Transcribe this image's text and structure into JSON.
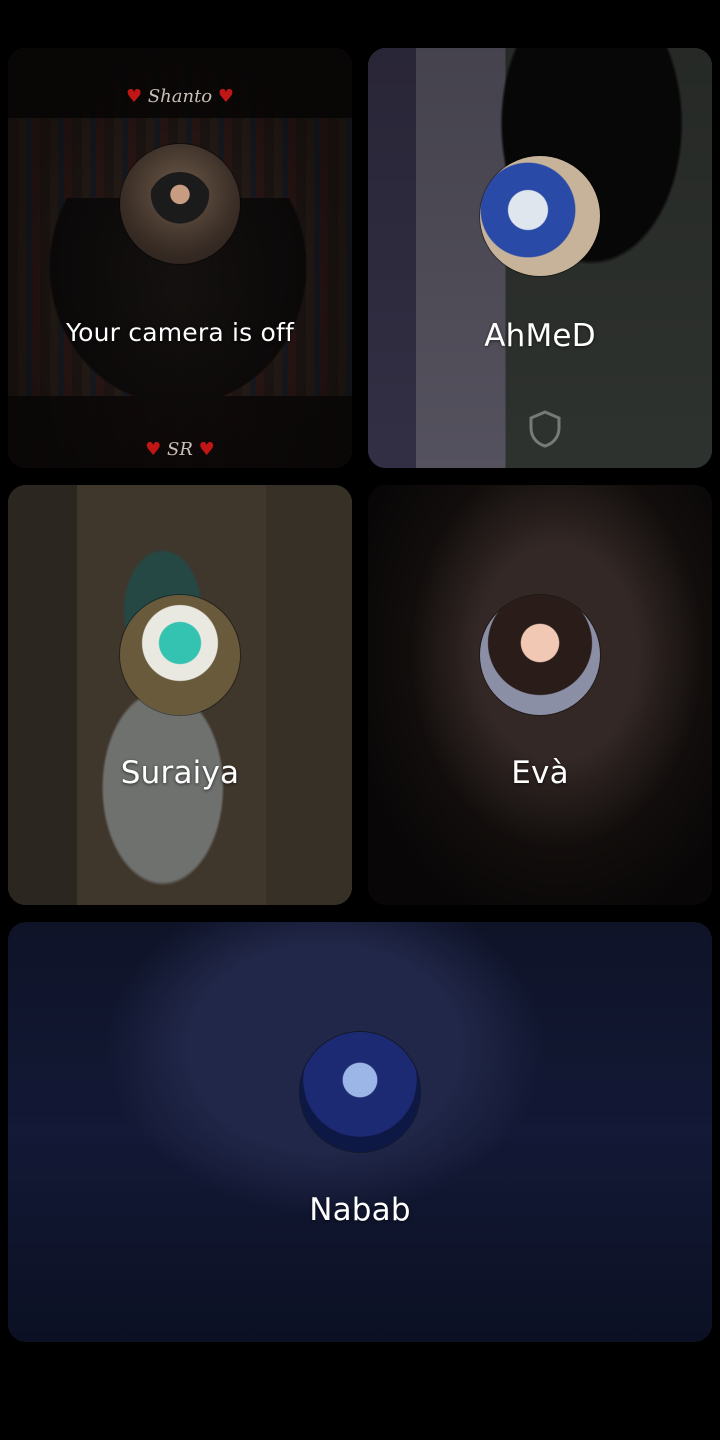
{
  "participants": [
    {
      "id": "self",
      "label": "Your camera is off",
      "banner_top": "Shanto",
      "banner_bottom": "SR",
      "is_self": true
    },
    {
      "id": "ahmed",
      "label": "AhMeD",
      "is_self": false
    },
    {
      "id": "suraiya",
      "label": "Suraiya",
      "is_self": false
    },
    {
      "id": "eva",
      "label": "Evà",
      "is_self": false
    },
    {
      "id": "nabab",
      "label": "Nabab",
      "is_self": false
    }
  ],
  "icons": {
    "self_avatar": "profile-photo",
    "shield": "shield-icon"
  },
  "colors": {
    "background": "#000000",
    "label_text": "#ffffff",
    "heart": "#c01616"
  }
}
